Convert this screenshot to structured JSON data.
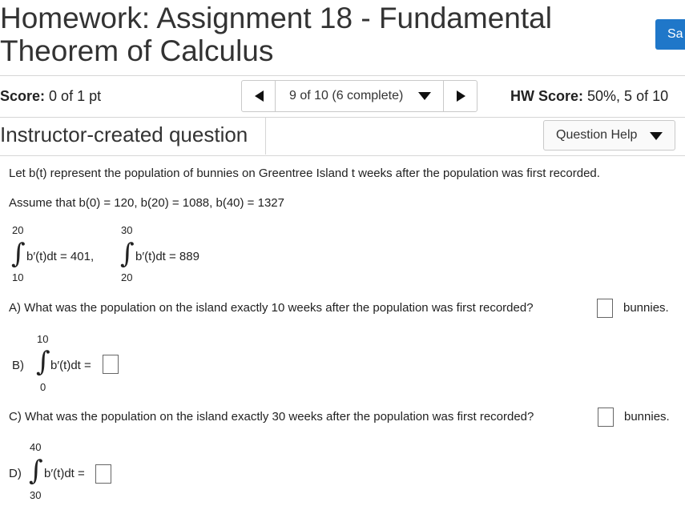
{
  "header": {
    "title": "Homework: Assignment 18 - Fundamental Theorem of Calculus",
    "save_label": "Sa"
  },
  "status_bar": {
    "score_label": "Score:",
    "score_value": "0 of 1 pt",
    "nav_label": "9 of 10 (6 complete)",
    "hw_score_label": "HW Score:",
    "hw_score_value": "50%, 5 of 10"
  },
  "question_header": {
    "type": "Instructor-created question",
    "help_label": "Question Help"
  },
  "question": {
    "intro": "Let b(t) represent the population of bunnies on Greentree Island t weeks after the population was first recorded.",
    "assume": "Assume that  b(0) = 120,   b(20) = 1088,  b(40) = 1327",
    "given": [
      {
        "upper": "20",
        "lower": "10",
        "expr": "b′(t)dt = 401,"
      },
      {
        "upper": "30",
        "lower": "20",
        "expr": "b′(t)dt = 889"
      }
    ],
    "part_a": {
      "text": "A) What was the population on the island exactly 10 weeks after the population was first recorded?",
      "unit": "bunnies."
    },
    "part_b": {
      "label": "B)",
      "upper": "10",
      "lower": "0",
      "expr": "b′(t)dt ="
    },
    "part_c": {
      "text": "C) What was the population on the island exactly 30 weeks after the population was first recorded?",
      "unit": "bunnies."
    },
    "part_d": {
      "label": "D)",
      "upper": "40",
      "lower": "30",
      "expr": "b′(t)dt ="
    }
  }
}
